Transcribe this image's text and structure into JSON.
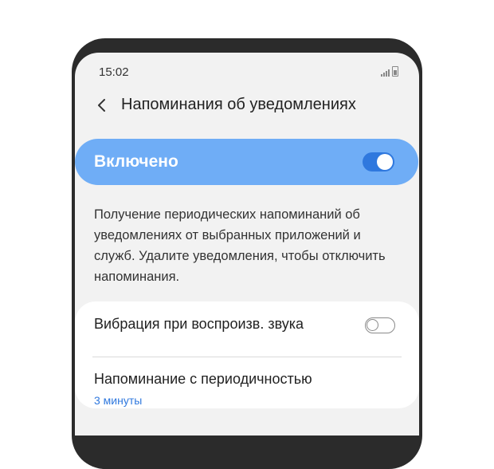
{
  "status_bar": {
    "time": "15:02"
  },
  "header": {
    "title": "Напоминания об уведомлениях",
    "back_icon": "chevron-left-icon"
  },
  "master_switch": {
    "label": "Включено",
    "on": true,
    "accent": "#6fadf6",
    "toggle_color": "#2f78de"
  },
  "description": "Получение периодических напоминаний об уведомлениях от выбранных приложений и служб. Удалите уведомления, чтобы отключить напоминания.",
  "settings": {
    "vibration": {
      "label": "Вибрация при воспроизв. звука",
      "on": false
    },
    "reminder": {
      "label": "Напоминание с периодичностью",
      "value": "3 минуты",
      "value_color": "#2f78de"
    }
  }
}
